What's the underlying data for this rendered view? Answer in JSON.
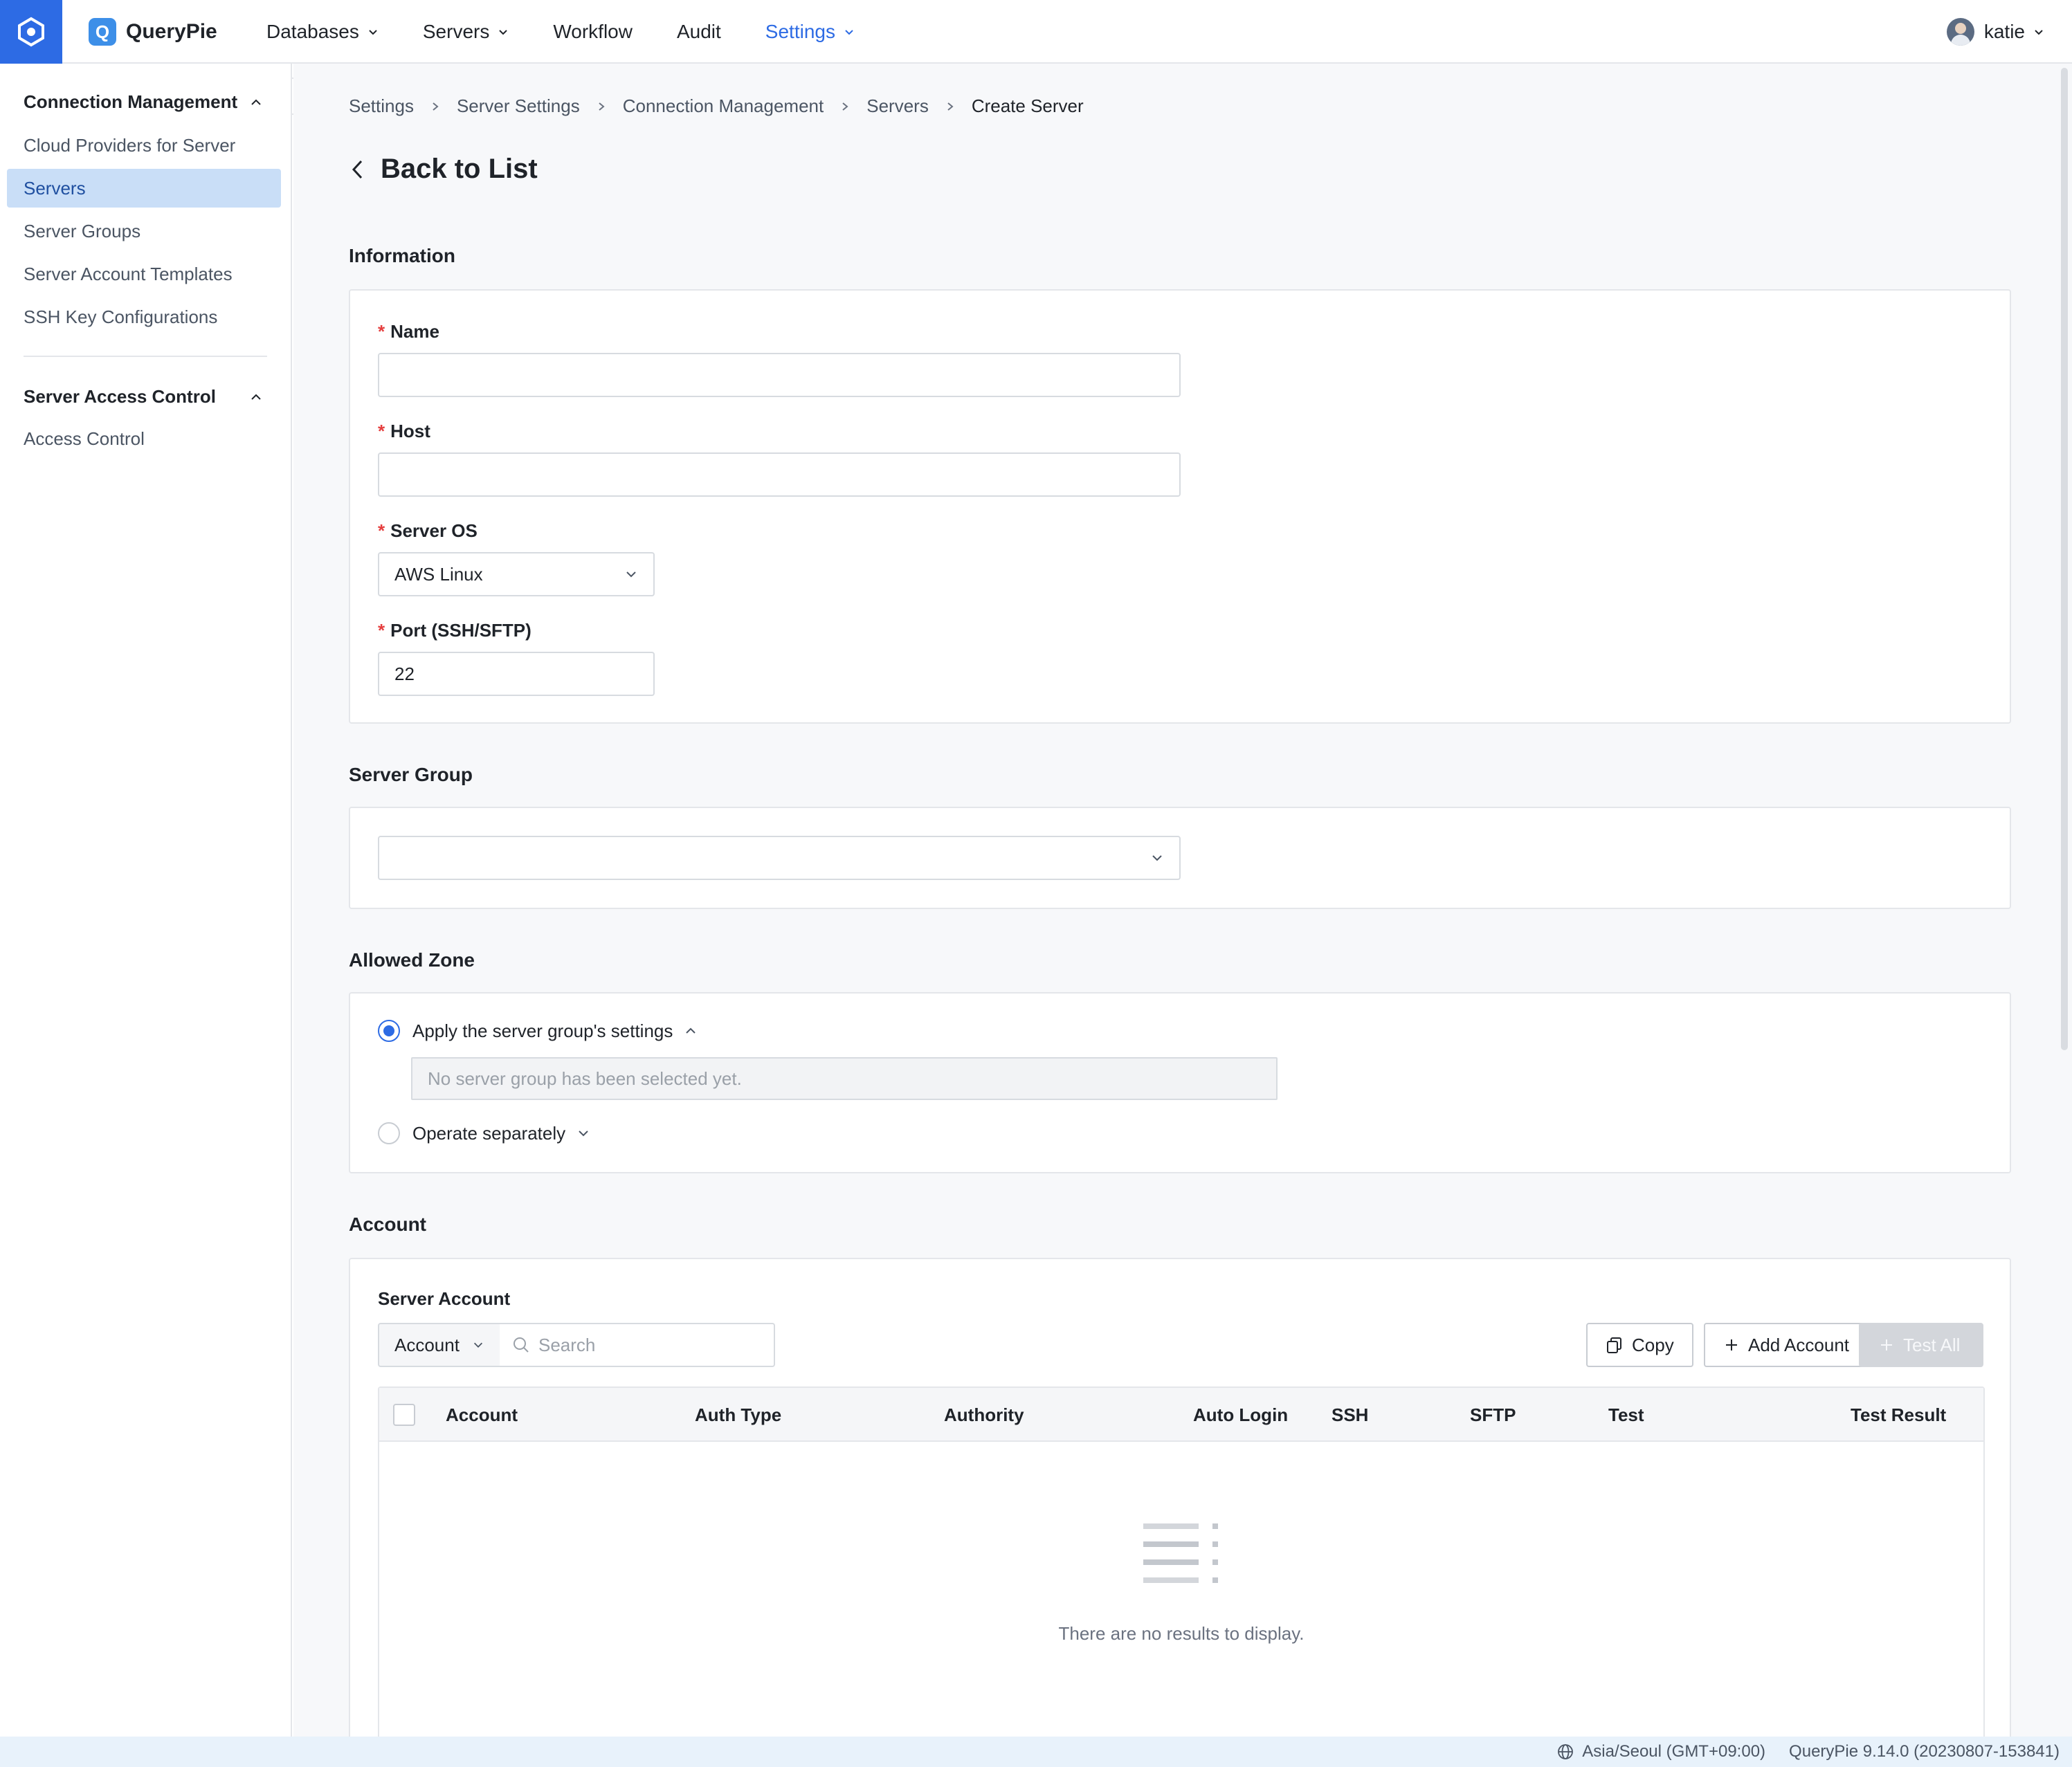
{
  "brand": {
    "name": "QueryPie",
    "logo_letter": "Q"
  },
  "nav": {
    "items": [
      {
        "label": "Databases",
        "has_dropdown": true
      },
      {
        "label": "Servers",
        "has_dropdown": true
      },
      {
        "label": "Workflow",
        "has_dropdown": false
      },
      {
        "label": "Audit",
        "has_dropdown": false
      },
      {
        "label": "Settings",
        "has_dropdown": true,
        "active": true
      }
    ],
    "user": "katie"
  },
  "sidebar": {
    "sections": [
      {
        "title": "Connection Management",
        "expanded": true,
        "items": [
          "Cloud Providers for Server",
          "Servers",
          "Server Groups",
          "Server Account Templates",
          "SSH Key Configurations"
        ],
        "selected": "Servers"
      },
      {
        "title": "Server Access Control",
        "expanded": true,
        "items": [
          "Access Control"
        ]
      }
    ]
  },
  "breadcrumb": [
    "Settings",
    "Server Settings",
    "Connection Management",
    "Servers",
    "Create Server"
  ],
  "back_label": "Back to List",
  "information": {
    "title": "Information",
    "name": {
      "label": "Name",
      "value": ""
    },
    "host": {
      "label": "Host",
      "value": ""
    },
    "server_os": {
      "label": "Server OS",
      "value": "AWS Linux"
    },
    "port": {
      "label": "Port (SSH/SFTP)",
      "value": "22"
    }
  },
  "server_group": {
    "title": "Server Group",
    "value": ""
  },
  "allowed_zone": {
    "title": "Allowed Zone",
    "option_group": "Apply the server group's settings",
    "option_group_note": "No server group has been selected yet.",
    "option_separate": "Operate separately",
    "selected": "group"
  },
  "account": {
    "title": "Account",
    "subtitle": "Server Account",
    "filter_select": "Account",
    "search_placeholder": "Search",
    "buttons": {
      "copy": "Copy",
      "add": "Add Account",
      "test_all": "Test All"
    },
    "columns": [
      "Account",
      "Auth Type",
      "Authority",
      "Auto Login",
      "SSH",
      "SFTP",
      "Test",
      "Test Result"
    ],
    "empty_text": "There are no results to display."
  },
  "footer": {
    "timezone": "Asia/Seoul (GMT+09:00)",
    "version": "QueryPie 9.14.0 (20230807-153841)"
  },
  "colors": {
    "accent": "#2d6be4",
    "selected_bg": "#c9def7",
    "required": "#e53e3e"
  }
}
